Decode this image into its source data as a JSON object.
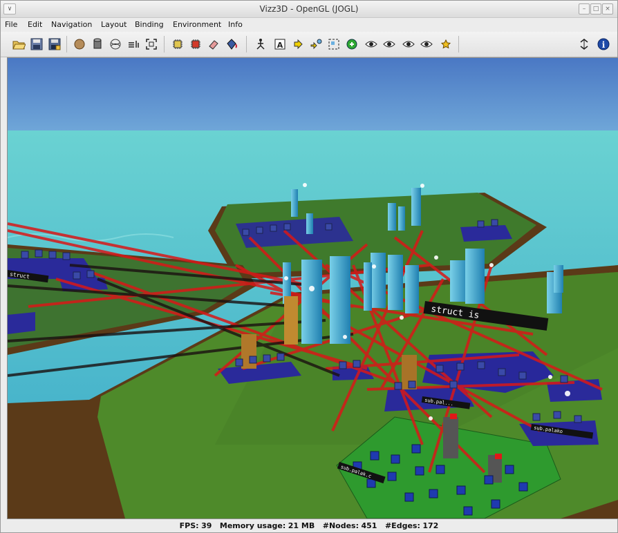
{
  "window": {
    "title": "Vizz3D - OpenGL (JOGL)"
  },
  "menu": [
    "File",
    "Edit",
    "Navigation",
    "Layout",
    "Binding",
    "Environment",
    "Info"
  ],
  "toolbar": {
    "buttons": [
      "open-folder-icon",
      "save-icon",
      "save-as-icon",
      "sphere-icon",
      "cylinder-icon",
      "wireframe-icon",
      "align-icon",
      "fit-view-icon",
      "chip-icon",
      "chip-red-icon",
      "eraser-icon",
      "paint-bucket-icon",
      "figure-icon",
      "label-icon",
      "arrow-right-icon",
      "pair-icon",
      "selection-icon",
      "green-circle-icon",
      "eye-icon",
      "eye-icon",
      "eye-icon",
      "eye-icon",
      "star-icon",
      "sync-icon",
      "info-icon"
    ]
  },
  "scene": {
    "labels": [
      "struct is",
      "struct",
      "sub.palako",
      "sub.pal...",
      "sub.palak.c"
    ]
  },
  "status": {
    "fps_label": "FPS:",
    "fps": "39",
    "memory_label": "Memory usage:",
    "memory": "21 MB",
    "nodes_label": "#Nodes:",
    "nodes": "451",
    "edges_label": "#Edges:",
    "edges": "172"
  },
  "colors": {
    "edge": "#d81818",
    "water": "#43bcc4",
    "sky": "#4a78c4",
    "grass": "#4e8a2a",
    "plate": "#2a2a9a"
  }
}
